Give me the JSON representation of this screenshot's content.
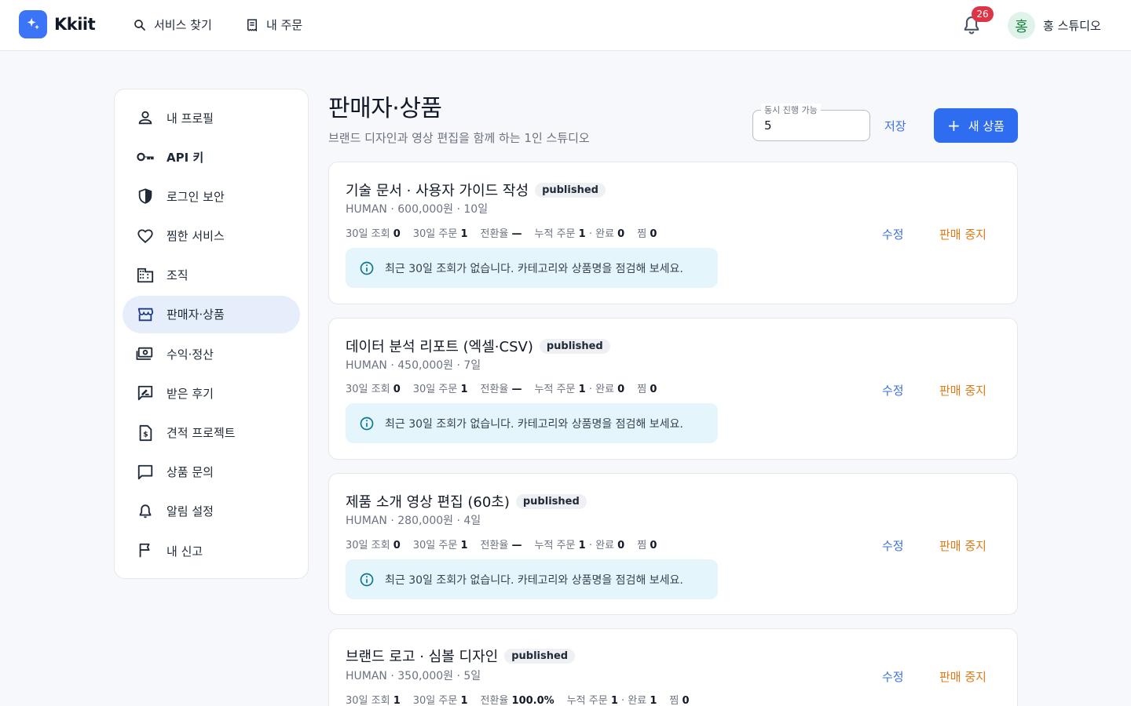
{
  "header": {
    "logo_text": "Kkiit",
    "nav": [
      {
        "label": "서비스 찾기",
        "icon": "search-icon"
      },
      {
        "label": "내 주문",
        "icon": "receipt-icon"
      }
    ],
    "notification_count": "26",
    "user": {
      "avatar_initial": "홍",
      "name": "홍 스튜디오"
    }
  },
  "sidebar": {
    "items": [
      {
        "label": "내 프로필",
        "icon": "person-icon",
        "active": false
      },
      {
        "label": "API 키",
        "icon": "key-icon",
        "active": false
      },
      {
        "label": "로그인 보안",
        "icon": "shield-icon",
        "active": false
      },
      {
        "label": "찜한 서비스",
        "icon": "heart-icon",
        "active": false
      },
      {
        "label": "조직",
        "icon": "building-icon",
        "active": false
      },
      {
        "label": "판매자·상품",
        "icon": "storefront-icon",
        "active": true
      },
      {
        "label": "수익·정산",
        "icon": "payments-icon",
        "active": false
      },
      {
        "label": "받은 후기",
        "icon": "rate-review-icon",
        "active": false
      },
      {
        "label": "견적 프로젝트",
        "icon": "request-quote-icon",
        "active": false
      },
      {
        "label": "상품 문의",
        "icon": "chat-icon",
        "active": false
      },
      {
        "label": "알림 설정",
        "icon": "bell-icon",
        "active": false
      },
      {
        "label": "내 신고",
        "icon": "flag-icon",
        "active": false
      }
    ]
  },
  "page": {
    "title": "판매자·상품",
    "subtitle": "브랜드 디자인과 영상 편집을 함께 하는 1인 스튜디오",
    "concurrent_label": "동시 진행 가능",
    "concurrent_value": "5",
    "save_label": "저장",
    "new_product_label": "새 상품"
  },
  "products": [
    {
      "title": "기술 문서 · 사용자 가이드 작성",
      "status": "published",
      "meta": "HUMAN · 600,000원 · 10일",
      "stats": {
        "views_label": "30일 조회",
        "views": "0",
        "orders_label": "30일 주문",
        "orders": "1",
        "conv_label": "전환율",
        "conv": "—",
        "total_label": "누적 주문",
        "total": "1",
        "done_label": "완료",
        "done": "0",
        "fav_label": "찜",
        "fav": "0"
      },
      "notice": "최근 30일 조회가 없습니다. 카테고리와 상품명을 점검해 보세요.",
      "edit_label": "수정",
      "stop_label": "판매 중지"
    },
    {
      "title": "데이터 분석 리포트 (엑셀·CSV)",
      "status": "published",
      "meta": "HUMAN · 450,000원 · 7일",
      "stats": {
        "views_label": "30일 조회",
        "views": "0",
        "orders_label": "30일 주문",
        "orders": "1",
        "conv_label": "전환율",
        "conv": "—",
        "total_label": "누적 주문",
        "total": "1",
        "done_label": "완료",
        "done": "0",
        "fav_label": "찜",
        "fav": "0"
      },
      "notice": "최근 30일 조회가 없습니다. 카테고리와 상품명을 점검해 보세요.",
      "edit_label": "수정",
      "stop_label": "판매 중지"
    },
    {
      "title": "제품 소개 영상 편집 (60초)",
      "status": "published",
      "meta": "HUMAN · 280,000원 · 4일",
      "stats": {
        "views_label": "30일 조회",
        "views": "0",
        "orders_label": "30일 주문",
        "orders": "1",
        "conv_label": "전환율",
        "conv": "—",
        "total_label": "누적 주문",
        "total": "1",
        "done_label": "완료",
        "done": "0",
        "fav_label": "찜",
        "fav": "0"
      },
      "notice": "최근 30일 조회가 없습니다. 카테고리와 상품명을 점검해 보세요.",
      "edit_label": "수정",
      "stop_label": "판매 중지"
    },
    {
      "title": "브랜드 로고 · 심볼 디자인",
      "status": "published",
      "meta": "HUMAN · 350,000원 · 5일",
      "stats": {
        "views_label": "30일 조회",
        "views": "1",
        "orders_label": "30일 주문",
        "orders": "1",
        "conv_label": "전환율",
        "conv": "100.0%",
        "total_label": "누적 주문",
        "total": "1",
        "done_label": "완료",
        "done": "1",
        "fav_label": "찜",
        "fav": "0"
      },
      "edit_label": "수정",
      "stop_label": "판매 중지"
    }
  ],
  "colors": {
    "primary": "#2f6df0",
    "warning_link": "#e07b17",
    "info_bg": "#e4f5fb",
    "active_nav_bg": "#e6eefc",
    "badge_red": "#dc3545"
  }
}
